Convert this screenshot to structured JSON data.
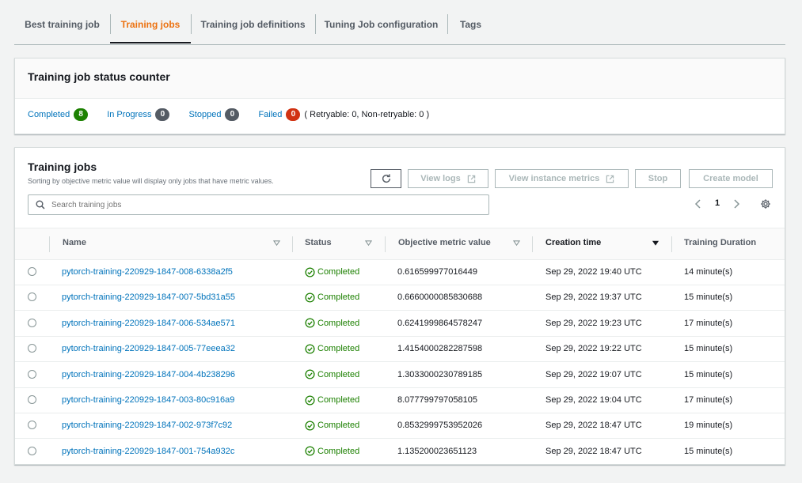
{
  "tabs": [
    {
      "label": "Best training job"
    },
    {
      "label": "Training jobs"
    },
    {
      "label": "Training job definitions"
    },
    {
      "label": "Tuning Job configuration"
    },
    {
      "label": "Tags"
    }
  ],
  "active_tab": "Training jobs",
  "status_counter": {
    "title": "Training job status counter",
    "completed": {
      "label": "Completed",
      "count": "8",
      "color": "#1d8102"
    },
    "in_progress": {
      "label": "In Progress",
      "count": "0"
    },
    "stopped": {
      "label": "Stopped",
      "count": "0"
    },
    "failed": {
      "label": "Failed",
      "count": "0",
      "color": "#d13212"
    },
    "retry_text": "( Retryable: 0, Non-retryable: 0 )"
  },
  "jobs_panel": {
    "title": "Training jobs",
    "description": "Sorting by objective metric value will display only jobs that have metric values.",
    "buttons": {
      "refresh_icon": "refresh-icon",
      "view_logs": "View logs",
      "view_instance_metrics": "View instance metrics",
      "stop": "Stop",
      "create_model": "Create model"
    },
    "search_placeholder": "Search training jobs",
    "page_number": "1"
  },
  "table": {
    "columns": {
      "name": "Name",
      "status": "Status",
      "objective": "Objective metric value",
      "creation": "Creation time",
      "duration": "Training Duration"
    },
    "rows": [
      {
        "name": "pytorch-training-220929-1847-008-6338a2f5",
        "status": "Completed",
        "objective": "0.616599977016449",
        "creation": "Sep 29, 2022 19:40 UTC",
        "duration": "14 minute(s)"
      },
      {
        "name": "pytorch-training-220929-1847-007-5bd31a55",
        "status": "Completed",
        "objective": "0.6660000085830688",
        "creation": "Sep 29, 2022 19:37 UTC",
        "duration": "15 minute(s)"
      },
      {
        "name": "pytorch-training-220929-1847-006-534ae571",
        "status": "Completed",
        "objective": "0.6241999864578247",
        "creation": "Sep 29, 2022 19:23 UTC",
        "duration": "17 minute(s)"
      },
      {
        "name": "pytorch-training-220929-1847-005-77eeea32",
        "status": "Completed",
        "objective": "1.4154000282287598",
        "creation": "Sep 29, 2022 19:22 UTC",
        "duration": "15 minute(s)"
      },
      {
        "name": "pytorch-training-220929-1847-004-4b238296",
        "status": "Completed",
        "objective": "1.3033000230789185",
        "creation": "Sep 29, 2022 19:07 UTC",
        "duration": "15 minute(s)"
      },
      {
        "name": "pytorch-training-220929-1847-003-80c916a9",
        "status": "Completed",
        "objective": "8.077799797058105",
        "creation": "Sep 29, 2022 19:04 UTC",
        "duration": "17 minute(s)"
      },
      {
        "name": "pytorch-training-220929-1847-002-973f7c92",
        "status": "Completed",
        "objective": "0.8532999753952026",
        "creation": "Sep 29, 2022 18:47 UTC",
        "duration": "19 minute(s)"
      },
      {
        "name": "pytorch-training-220929-1847-001-754a932c",
        "status": "Completed",
        "objective": "1.135200023651123",
        "creation": "Sep 29, 2022 18:47 UTC",
        "duration": "15 minute(s)"
      }
    ]
  }
}
